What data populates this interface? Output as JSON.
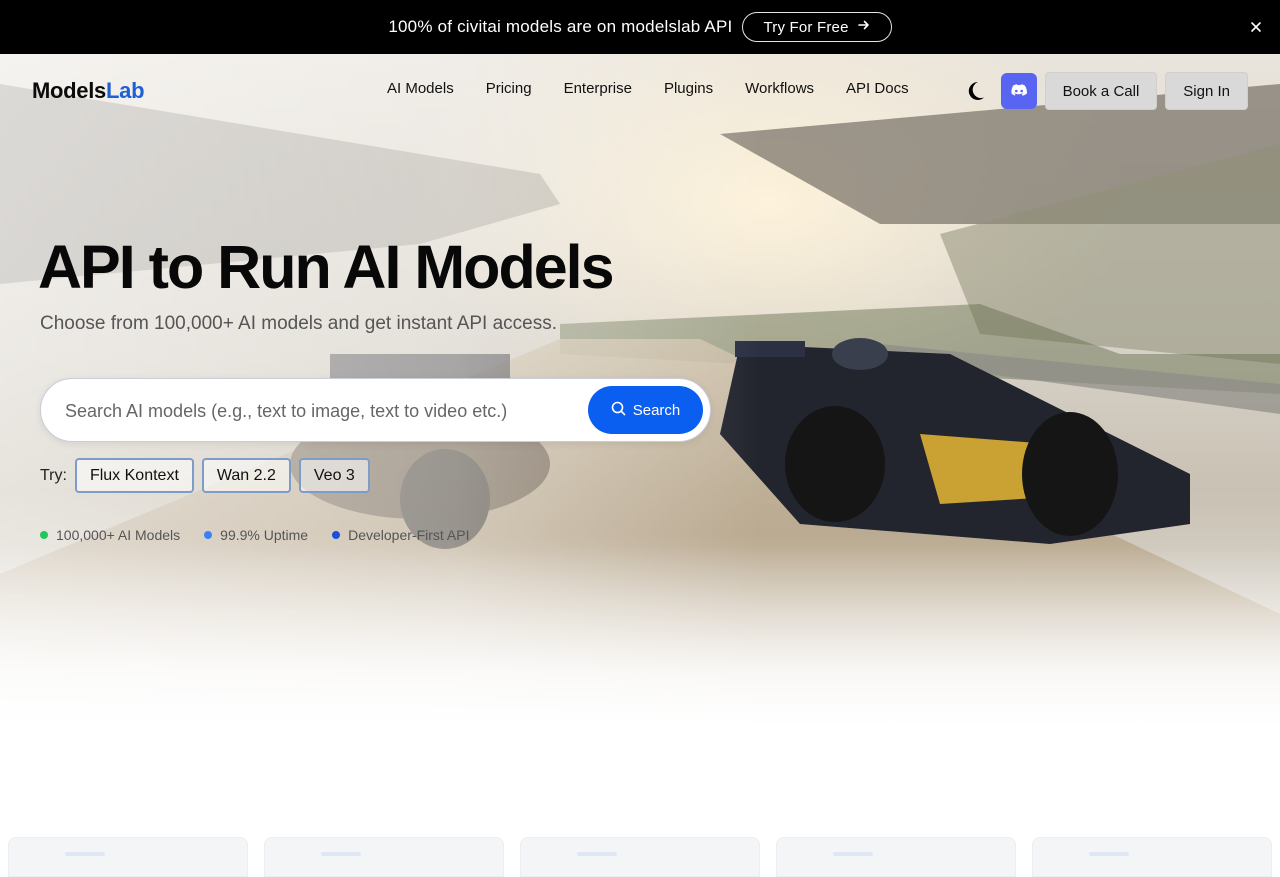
{
  "banner": {
    "text": "100% of civitai models are on modelslab API",
    "cta_label": "Try For Free"
  },
  "logo": {
    "part1": "Models",
    "part2": "Lab"
  },
  "nav": {
    "links": [
      "AI Models",
      "Pricing",
      "Enterprise",
      "Plugins",
      "Workflows",
      "API Docs"
    ],
    "book_call": "Book a Call",
    "sign_in": "Sign In"
  },
  "hero": {
    "title": "API to Run AI Models",
    "subtitle": "Choose from 100,000+ AI models and get instant API access.",
    "search_placeholder": "Search AI models (e.g., text to image, text to video etc.)",
    "search_button": "Search",
    "try_label": "Try:",
    "try_chips": [
      "Flux Kontext",
      "Wan 2.2",
      "Veo 3"
    ],
    "stats": [
      {
        "label": "100,000+ AI Models",
        "color": "#22c55e"
      },
      {
        "label": "99.9% Uptime",
        "color": "#3b82f6"
      },
      {
        "label": "Developer-First API",
        "color": "#1d4ed8"
      }
    ]
  },
  "colors": {
    "accent": "#0b5ff0",
    "discord": "#5865f2",
    "logo_accent": "#1c5fd6"
  },
  "icons": {
    "banner_cta": "arrow-right-icon",
    "banner_close": "close-icon",
    "theme": "moon-icon",
    "discord": "discord-icon",
    "search": "search-icon"
  }
}
